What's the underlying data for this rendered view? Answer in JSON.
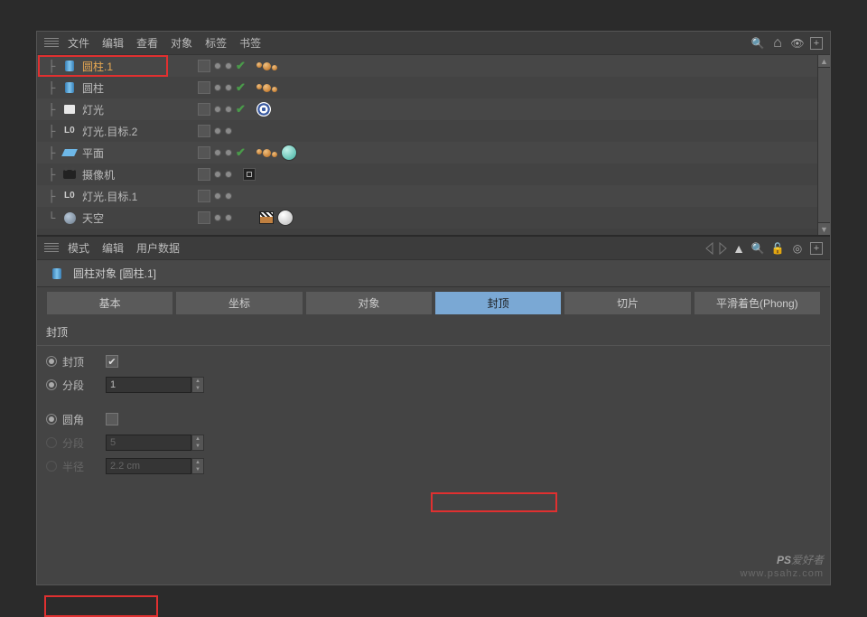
{
  "top_menu": {
    "items": [
      "文件",
      "编辑",
      "查看",
      "对象",
      "标签",
      "书签"
    ]
  },
  "toolbar_icons": {
    "search": "🔍",
    "home": "⌂",
    "eye": "◉",
    "plus": "+"
  },
  "objects": [
    {
      "name": "圆柱.1",
      "icon": "cylinder",
      "selected": true,
      "tags": [
        "dots"
      ]
    },
    {
      "name": "圆柱",
      "icon": "cylinder",
      "selected": false,
      "tags": [
        "dots"
      ]
    },
    {
      "name": "灯光",
      "icon": "light",
      "selected": false,
      "tags": [
        "target"
      ]
    },
    {
      "name": "灯光.目标.2",
      "icon": "null",
      "selected": false,
      "tags": []
    },
    {
      "name": "平面",
      "icon": "plane",
      "selected": false,
      "tags": [
        "dots",
        "teal"
      ]
    },
    {
      "name": "摄像机",
      "icon": "camera",
      "selected": false,
      "tags": [
        "box"
      ]
    },
    {
      "name": "灯光.目标.1",
      "icon": "null",
      "selected": false,
      "tags": []
    },
    {
      "name": "天空",
      "icon": "sky",
      "selected": false,
      "tags": [
        "clap",
        "white"
      ]
    }
  ],
  "attr_menu": {
    "items": [
      "模式",
      "编辑",
      "用户数据"
    ]
  },
  "attr_header": "圆柱对象 [圆柱.1]",
  "tabs": {
    "items": [
      "基本",
      "坐标",
      "对象",
      "封顶",
      "切片",
      "平滑着色(Phong)"
    ],
    "active_label": "封顶"
  },
  "section": "封顶",
  "props": {
    "cap_label": "封顶",
    "cap_checked": "✔",
    "seg_label": "分段",
    "seg_value": "1",
    "fillet_label": "圆角",
    "fseg_label": "分段",
    "fseg_value": "5",
    "radius_label": "半径",
    "radius_value": "2.2 cm"
  },
  "watermark": {
    "line1_a": "PS",
    "line1_b": "爱好者",
    "line2": "www.psahz.com"
  }
}
